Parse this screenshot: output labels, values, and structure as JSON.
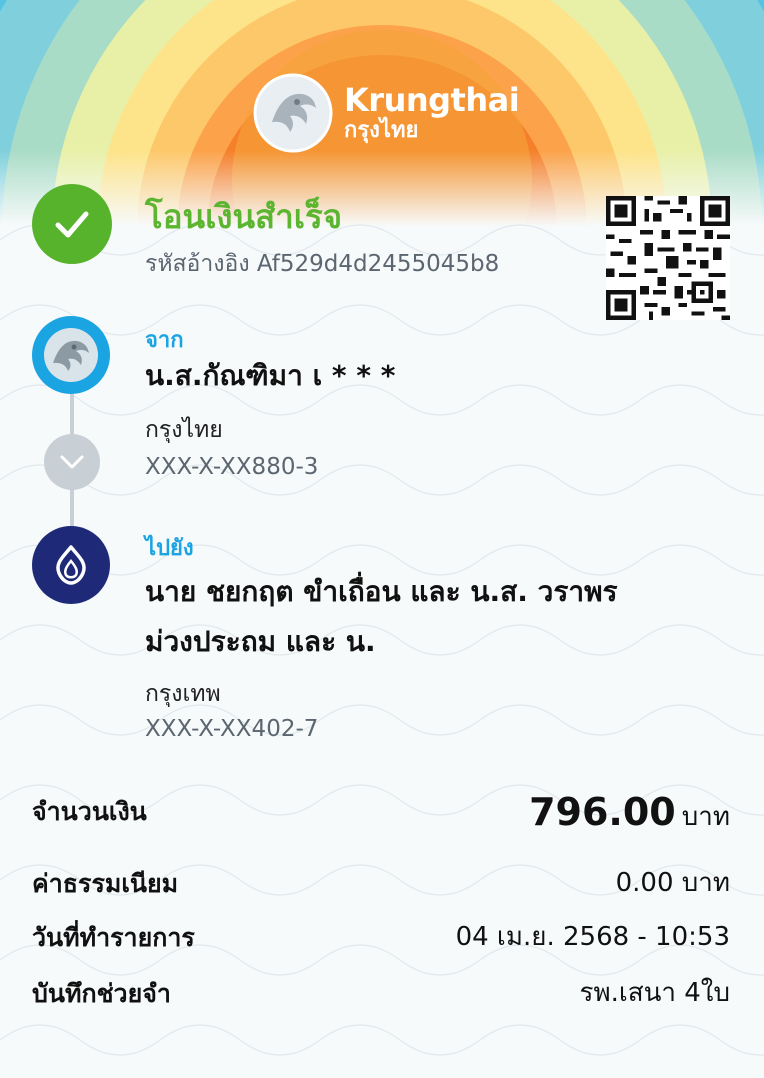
{
  "header": {
    "logo_en": "Krungthai",
    "logo_th": "กรุงไทย"
  },
  "status": {
    "title": "โอนเงินสำเร็จ",
    "reference": "รหัสอ้างอิง Af529d4d2455045b8"
  },
  "from": {
    "label": "จาก",
    "name": "น.ส.กัณฑิมา เ * * *",
    "bank": "กรุงไทย",
    "account": "XXX-X-XX880-3"
  },
  "to": {
    "label": "ไปยัง",
    "name_line1": "นาย ชยกฤต ขำเถื่อน และ น.ส. วราพร",
    "name_line2": "ม่วงประถม และ น.",
    "bank": "กรุงเทพ",
    "account": "XXX-X-XX402-7"
  },
  "details": {
    "amount_label": "จำนวนเงิน",
    "amount_value": "796.00",
    "amount_unit": "บาท",
    "fee_label": "ค่าธรรมเนียม",
    "fee_value": "0.00 บาท",
    "date_label": "วันที่ทำรายการ",
    "date_value": "04 เม.ย. 2568 - 10:53",
    "memo_label": "บันทึกช่วยจำ",
    "memo_value": "รพ.เสนา 4ใบ"
  },
  "colors": {
    "success": "#5cb531",
    "ktb_blue": "#1ba4e2",
    "bbl_navy": "#1e2a78",
    "secondary_text": "#5b6670"
  },
  "icons": {
    "success": "check-icon",
    "from_bank": "krungthai-logo-icon",
    "to_bank": "bangkok-bank-logo-icon",
    "flow": "chevron-down-icon",
    "qr": "qr-code-icon"
  }
}
